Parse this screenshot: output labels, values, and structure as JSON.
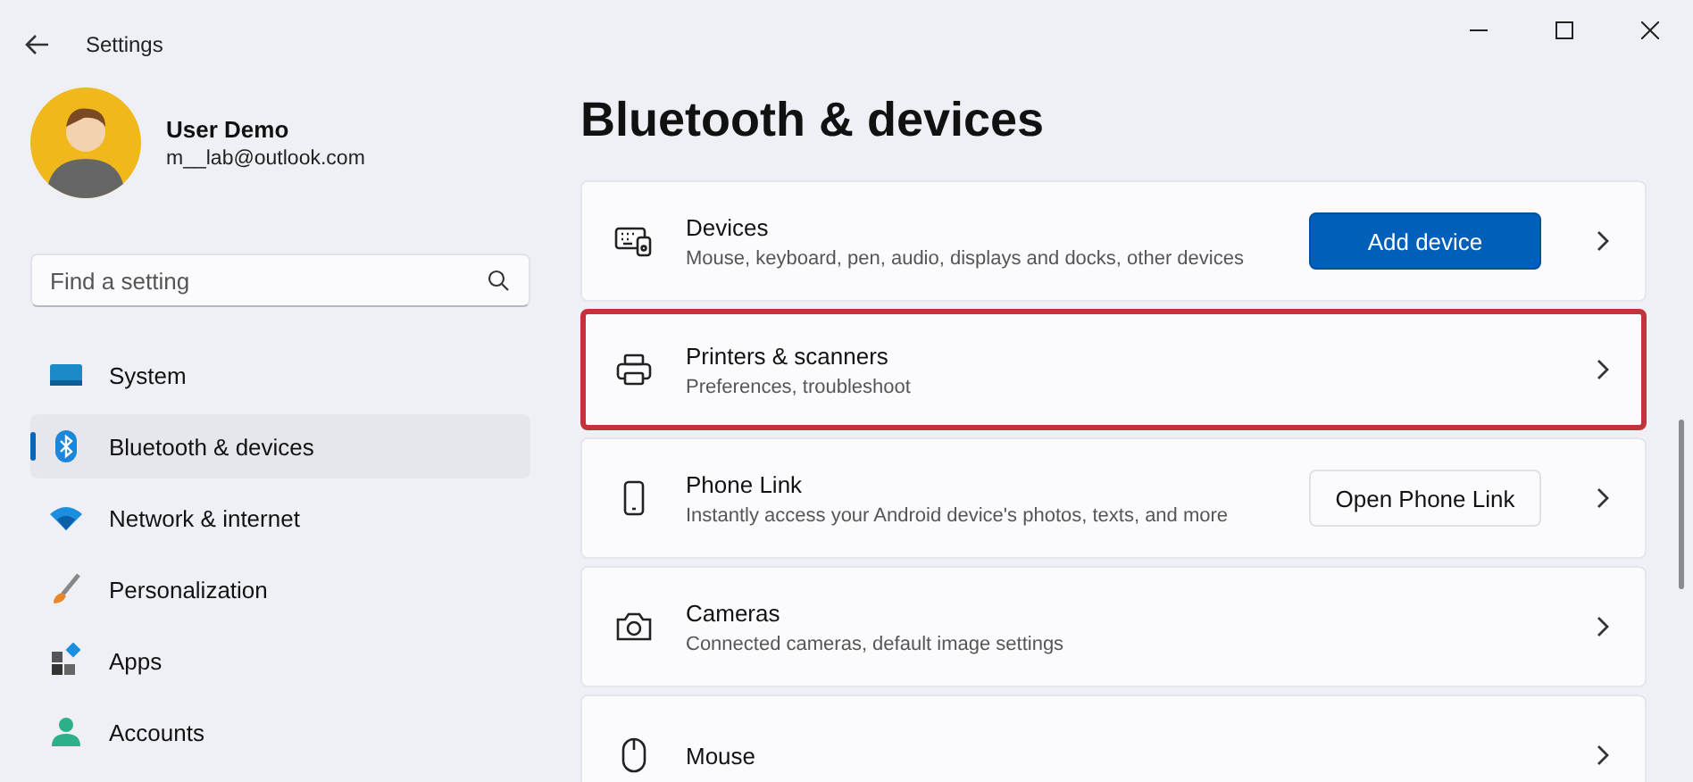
{
  "window": {
    "title": "Settings"
  },
  "user": {
    "name": "User Demo",
    "email": "m__lab@outlook.com"
  },
  "search": {
    "placeholder": "Find a setting"
  },
  "sidebar": {
    "items": [
      {
        "label": "System",
        "selected": false
      },
      {
        "label": "Bluetooth & devices",
        "selected": true
      },
      {
        "label": "Network & internet",
        "selected": false
      },
      {
        "label": "Personalization",
        "selected": false
      },
      {
        "label": "Apps",
        "selected": false
      },
      {
        "label": "Accounts",
        "selected": false
      }
    ]
  },
  "page": {
    "title": "Bluetooth & devices"
  },
  "cards": [
    {
      "title": "Devices",
      "subtitle": "Mouse, keyboard, pen, audio, displays and docks, other devices",
      "highlighted": false,
      "button": {
        "label": "Add device",
        "kind": "primary"
      }
    },
    {
      "title": "Printers & scanners",
      "subtitle": "Preferences, troubleshoot",
      "highlighted": true
    },
    {
      "title": "Phone Link",
      "subtitle": "Instantly access your Android device's photos, texts, and more",
      "highlighted": false,
      "button": {
        "label": "Open Phone Link",
        "kind": "secondary"
      }
    },
    {
      "title": "Cameras",
      "subtitle": "Connected cameras, default image settings",
      "highlighted": false
    },
    {
      "title": "Mouse",
      "highlighted": false
    }
  ]
}
